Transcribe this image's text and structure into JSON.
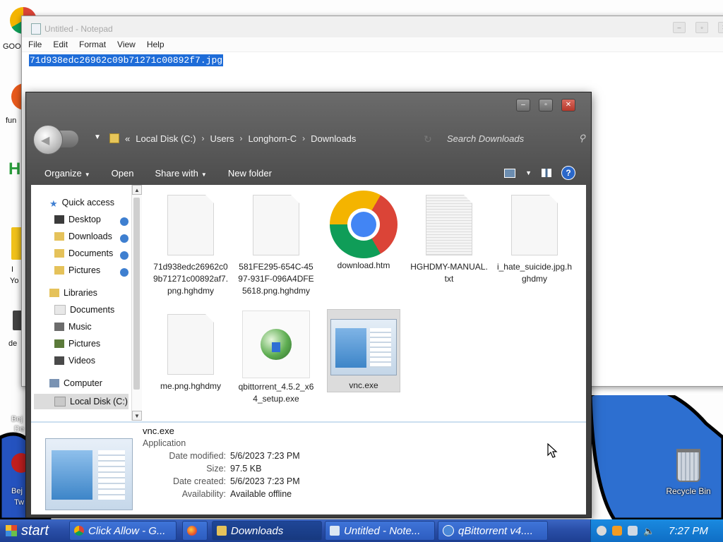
{
  "desktop": {
    "labels": [
      "GOO",
      "fun",
      "H",
      "I",
      "Yo",
      "de",
      "Bej",
      "De",
      "Bej",
      "Tw"
    ],
    "recycle_bin": "Recycle Bin"
  },
  "notepad": {
    "title": "Untitled - Notepad",
    "menu": [
      "File",
      "Edit",
      "Format",
      "View",
      "Help"
    ],
    "content": "71d938edc26962c09b71271c00892f7.jpg"
  },
  "explorer": {
    "address": {
      "chevrons": "«",
      "parts": [
        "Local Disk (C:)",
        "Users",
        "Longhorn-C",
        "Downloads"
      ],
      "separator": "›"
    },
    "search_placeholder": "Search Downloads",
    "toolbar": {
      "organize": "Organize",
      "open": "Open",
      "share_with": "Share with",
      "new_folder": "New folder"
    },
    "nav": [
      {
        "label": "Quick access",
        "icon": "star-icon",
        "indent": 0,
        "pinned": false
      },
      {
        "label": "Desktop",
        "icon": "desktop-icon",
        "indent": 1,
        "pinned": true
      },
      {
        "label": "Downloads",
        "icon": "downloads-icon",
        "indent": 1,
        "pinned": true
      },
      {
        "label": "Documents",
        "icon": "documents-icon",
        "indent": 1,
        "pinned": true
      },
      {
        "label": "Pictures",
        "icon": "pictures-icon",
        "indent": 1,
        "pinned": true
      },
      {
        "label": "Libraries",
        "icon": "libraries-icon",
        "indent": 0,
        "pinned": false
      },
      {
        "label": "Documents",
        "icon": "documents-icon",
        "indent": 1,
        "pinned": false
      },
      {
        "label": "Music",
        "icon": "music-icon",
        "indent": 1,
        "pinned": false
      },
      {
        "label": "Pictures",
        "icon": "pictures-icon",
        "indent": 1,
        "pinned": false
      },
      {
        "label": "Videos",
        "icon": "videos-icon",
        "indent": 1,
        "pinned": false
      },
      {
        "label": "Computer",
        "icon": "computer-icon",
        "indent": 0,
        "pinned": false
      },
      {
        "label": "Local Disk (C:)",
        "icon": "drive-icon",
        "indent": 1,
        "pinned": false
      }
    ],
    "files": [
      {
        "name": "71d938edc26962c09b71271c00892af7.png.hghdmy",
        "type": "doc"
      },
      {
        "name": "581FE295-654C-4597-931F-096A4DFE5618.png.hghdmy",
        "type": "doc"
      },
      {
        "name": "download.htm",
        "type": "chrome"
      },
      {
        "name": "HGHDMY-MANUAL.txt",
        "type": "txt"
      },
      {
        "name": "i_hate_suicide.jpg.hghdmy",
        "type": "doc"
      },
      {
        "name": "me.png.hghdmy",
        "type": "doc"
      },
      {
        "name": "qbittorrent_4.5.2_x64_setup.exe",
        "type": "qbit"
      },
      {
        "name": "vnc.exe",
        "type": "vnc"
      }
    ],
    "details": {
      "name": "vnc.exe",
      "type": "Application",
      "rows": [
        {
          "key": "Date modified:",
          "value": "5/6/2023 7:23 PM"
        },
        {
          "key": "Size:",
          "value": "97.5 KB"
        },
        {
          "key": "Date created:",
          "value": "5/6/2023 7:23 PM"
        },
        {
          "key": "Availability:",
          "value": "Available offline"
        }
      ]
    }
  },
  "taskbar": {
    "start": "start",
    "tasks": [
      {
        "label": "Click Allow - G...",
        "icon": "chrome-icon"
      },
      {
        "label": "",
        "icon": "firefox-icon"
      },
      {
        "label": "Downloads",
        "icon": "folder-icon"
      },
      {
        "label": "Untitled - Note...",
        "icon": "notepad-icon"
      },
      {
        "label": "qBittorrent v4....",
        "icon": "qbittorrent-icon"
      }
    ],
    "time": "7:27 PM"
  }
}
